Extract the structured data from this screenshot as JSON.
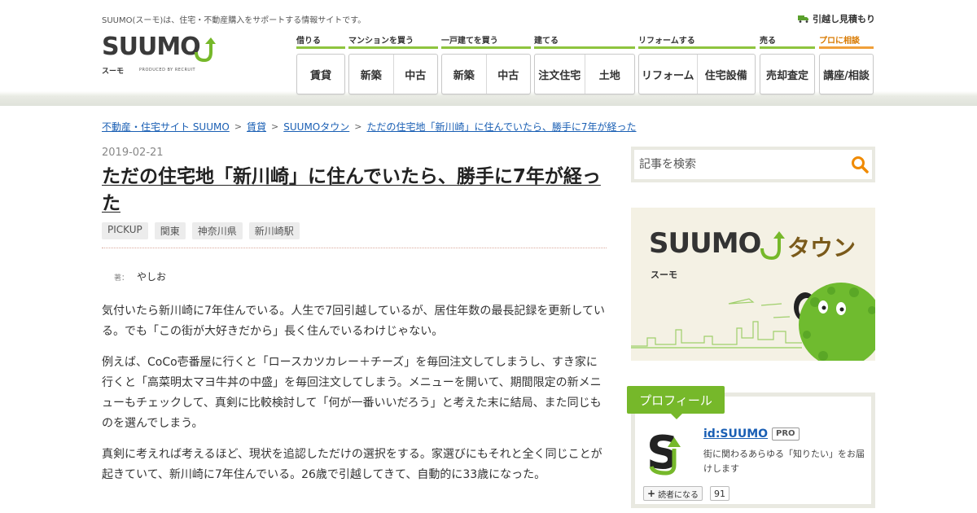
{
  "header": {
    "tagline": "SUUMO(スーモ)は、住宅・不動産購入をサポートする情報サイトです。",
    "moving_link": "引越し見積もり",
    "logo": {
      "word": "SUUMO",
      "sub": "スーモ",
      "produced": "PRODUCED BY RECRUIT"
    }
  },
  "nav": [
    {
      "label": "借りる",
      "buttons": [
        "賃貸"
      ]
    },
    {
      "label": "マンションを買う",
      "buttons": [
        "新築",
        "中古"
      ]
    },
    {
      "label": "一戸建てを買う",
      "buttons": [
        "新築",
        "中古"
      ]
    },
    {
      "label": "建てる",
      "buttons": [
        "注文住宅",
        "土地"
      ]
    },
    {
      "label": "リフォームする",
      "buttons": [
        "リフォーム",
        "住宅設備"
      ]
    },
    {
      "label": "売る",
      "buttons": [
        "売却査定"
      ]
    },
    {
      "label": "プロに相談",
      "buttons": [
        "講座/相談"
      ]
    }
  ],
  "breadcrumb": [
    "不動産・住宅サイト SUUMO",
    "賃貸",
    "SUUMOタウン",
    "ただの住宅地「新川崎」に住んでいたら、勝手に7年が経った"
  ],
  "article": {
    "date": "2019-02-21",
    "title": "ただの住宅地「新川崎」に住んでいたら、勝手に7年が経った",
    "tags": [
      "PICKUP",
      "関東",
      "神奈川県",
      "新川崎駅"
    ],
    "author_label": "著：",
    "author_name": "やしお",
    "paragraphs": [
      "気付いたら新川崎に7年住んでいる。人生で7回引越しているが、居住年数の最長記録を更新している。でも「この街が大好きだから」長く住んでいるわけじゃない。",
      "例えば、CoCo壱番屋に行くと「ロースカツカレー＋チーズ」を毎回注文してしまうし、すき家に行くと「高菜明太マヨ牛丼の中盛」を毎回注文してしまう。メニューを開いて、期間限定の新メニューもチェックして、真剣に比較検討して「何が一番いいだろう」と考えた末に結局、また同じものを選んでしまう。",
      "真剣に考えれば考えるほど、現状を追認しただけの選択をする。家選びにもそれと全く同じことが起きていて、新川崎に7年住んでいる。26歳で引越してきて、自動的に33歳になった。"
    ]
  },
  "sidebar": {
    "search_placeholder": "記事を検索",
    "banner": {
      "word": "SUUMO",
      "town": "タウン",
      "sub": "スーモ"
    },
    "profile": {
      "tab": "プロフィール",
      "id": "id:SUUMO",
      "badge": "PRO",
      "description": "街に関わるあらゆる「知りたい」をお届けします",
      "reader_button": "読者になる",
      "reader_count": "91"
    }
  },
  "colors": {
    "brand_green": "#76b82a",
    "link": "#1a5fb4",
    "nav_accent": "#8ec43e",
    "pro_accent": "#f0a03a"
  }
}
